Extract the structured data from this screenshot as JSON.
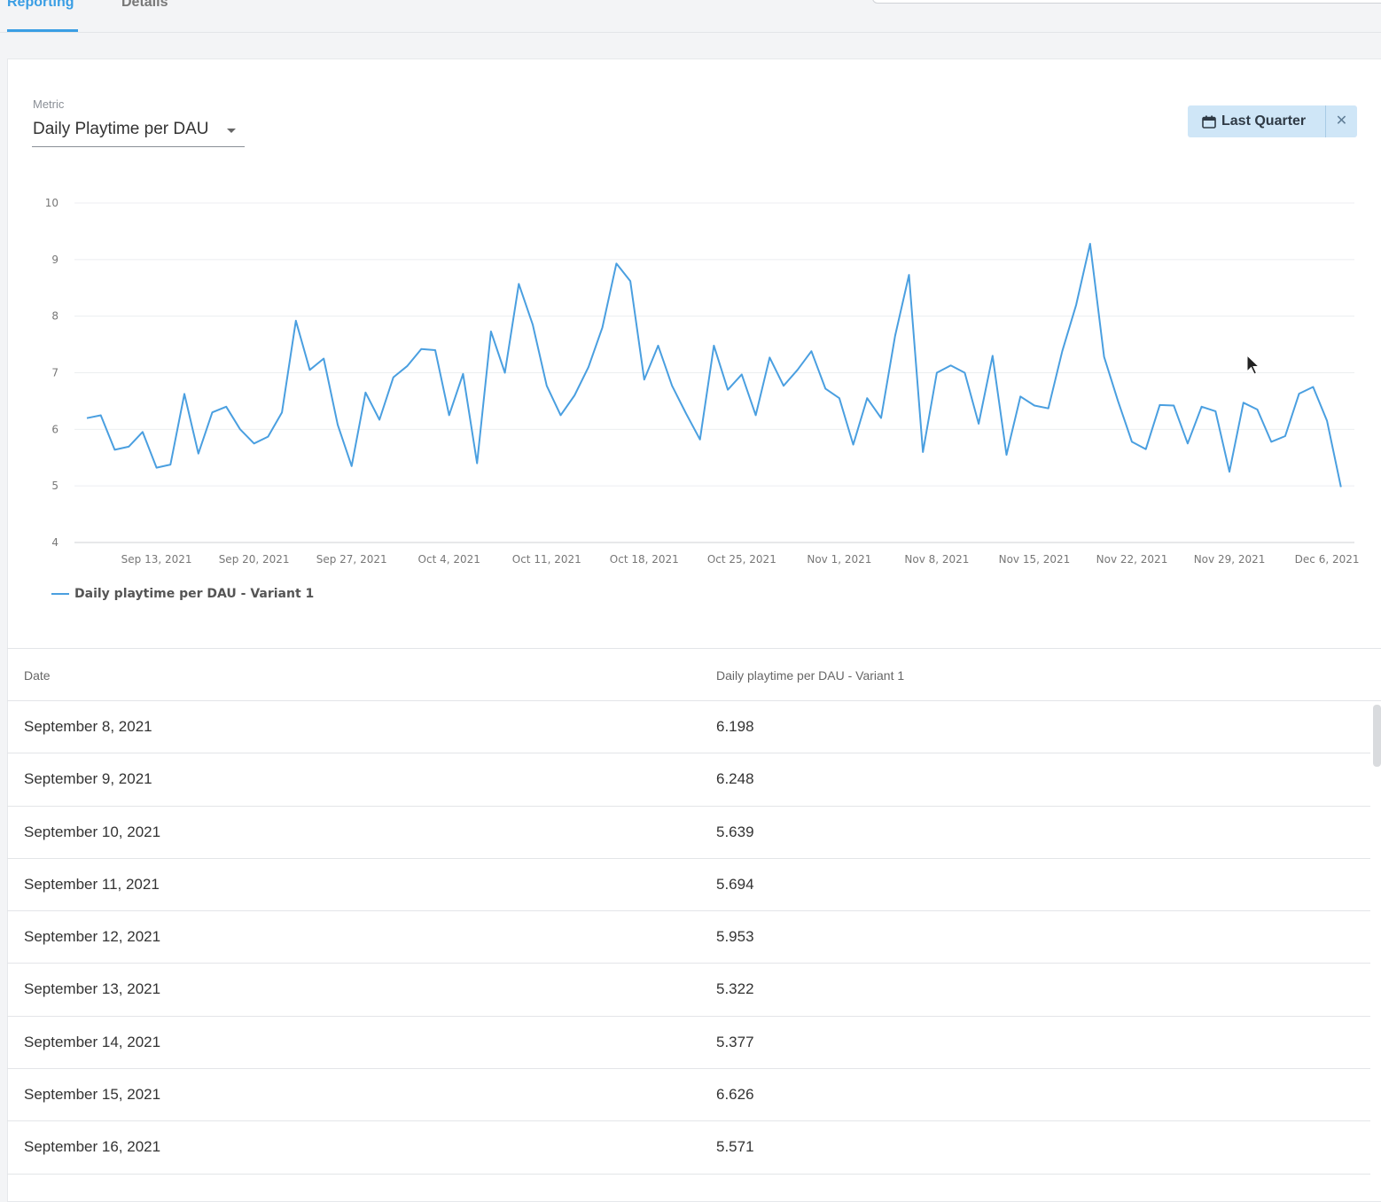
{
  "tabs": [
    {
      "label": "Reporting",
      "active": true
    },
    {
      "label": "Details",
      "active": false
    }
  ],
  "metric": {
    "label": "Metric",
    "value": "Daily Playtime per DAU"
  },
  "date_filter": {
    "icon": "calendar-icon",
    "label": "Last Quarter",
    "close": "✕"
  },
  "colors": {
    "accent": "#3a9ee4",
    "line": "#4a9fe0",
    "chip": "#cfe6f7"
  },
  "chart_data": {
    "type": "line",
    "title": "",
    "xlabel": "",
    "ylabel": "",
    "ylim": [
      4,
      10
    ],
    "yticks": [
      4,
      5,
      6,
      7,
      8,
      9,
      10
    ],
    "grid": true,
    "legend": "bottom-left",
    "x_start": "Sep 8, 2021",
    "x_tick_labels": [
      "Sep 13, 2021",
      "Sep 20, 2021",
      "Sep 27, 2021",
      "Oct 4, 2021",
      "Oct 11, 2021",
      "Oct 18, 2021",
      "Oct 25, 2021",
      "Nov 1, 2021",
      "Nov 8, 2021",
      "Nov 15, 2021",
      "Nov 22, 2021",
      "Nov 29, 2021",
      "Dec 6, 2021"
    ],
    "series": [
      {
        "name": "Daily playtime per DAU - Variant 1",
        "values": [
          6.198,
          6.248,
          5.639,
          5.694,
          5.953,
          5.322,
          5.377,
          6.626,
          5.571,
          6.3,
          6.4,
          6.0,
          5.75,
          5.87,
          6.3,
          7.92,
          7.05,
          7.25,
          6.08,
          5.35,
          6.65,
          6.17,
          6.92,
          7.12,
          7.42,
          7.4,
          6.25,
          6.98,
          5.4,
          7.73,
          7.0,
          8.57,
          7.85,
          6.77,
          6.25,
          6.6,
          7.1,
          7.8,
          8.93,
          8.62,
          6.88,
          7.48,
          6.77,
          6.28,
          5.82,
          7.48,
          6.7,
          6.97,
          6.25,
          7.27,
          6.77,
          7.05,
          7.38,
          6.72,
          6.55,
          5.73,
          6.55,
          6.2,
          7.65,
          8.73,
          5.6,
          7.0,
          7.13,
          7.0,
          6.1,
          7.3,
          5.55,
          6.58,
          6.42,
          6.37,
          7.38,
          8.2,
          9.28,
          7.28,
          6.5,
          5.78,
          5.65,
          6.43,
          6.42,
          5.75,
          6.4,
          6.32,
          5.25,
          6.47,
          6.35,
          5.78,
          5.88,
          6.63,
          6.75,
          6.15,
          4.98
        ]
      }
    ]
  },
  "table": {
    "headers": [
      "Date",
      "Daily playtime per DAU - Variant 1"
    ],
    "rows": [
      [
        "September 8, 2021",
        "6.198"
      ],
      [
        "September 9, 2021",
        "6.248"
      ],
      [
        "September 10, 2021",
        "5.639"
      ],
      [
        "September 11, 2021",
        "5.694"
      ],
      [
        "September 12, 2021",
        "5.953"
      ],
      [
        "September 13, 2021",
        "5.322"
      ],
      [
        "September 14, 2021",
        "5.377"
      ],
      [
        "September 15, 2021",
        "6.626"
      ],
      [
        "September 16, 2021",
        "5.571"
      ]
    ]
  }
}
